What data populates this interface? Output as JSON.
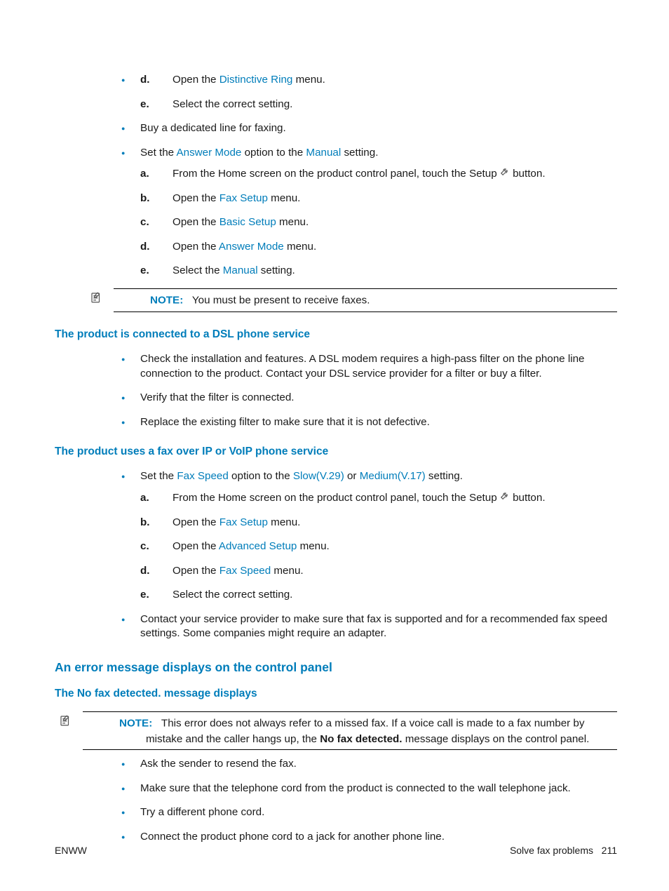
{
  "colors": {
    "accent": "#007dba"
  },
  "icons": {
    "note": "note-icon",
    "wrench": "wrench-icon"
  },
  "top_list": {
    "ol_cont": [
      {
        "m": "d.",
        "pre": "Open the ",
        "ui": "Distinctive Ring",
        "post": " menu."
      },
      {
        "m": "e.",
        "text": "Select the correct setting."
      }
    ],
    "item_buy": "Buy a dedicated line for faxing.",
    "item_set": {
      "pre": "Set the ",
      "ui1": "Answer Mode",
      "mid": " option to the ",
      "ui2": "Manual",
      "post": " setting."
    },
    "set_steps": [
      {
        "m": "a.",
        "pre": "From the Home screen on the product control panel, touch the Setup ",
        "post": " button."
      },
      {
        "m": "b.",
        "pre": "Open the ",
        "ui": "Fax Setup",
        "post": " menu."
      },
      {
        "m": "c.",
        "pre": "Open the ",
        "ui": "Basic Setup",
        "post": " menu."
      },
      {
        "m": "d.",
        "pre": "Open the ",
        "ui": "Answer Mode",
        "post": " menu."
      },
      {
        "m": "e.",
        "pre": "Select the ",
        "ui": "Manual",
        "post": " setting."
      }
    ],
    "note_label": "NOTE:",
    "note_text": "You must be present to receive faxes."
  },
  "dsl": {
    "heading": "The product is connected to a DSL phone service",
    "items": [
      "Check the installation and features. A DSL modem requires a high-pass filter on the phone line connection to the product. Contact your DSL service provider for a filter or buy a filter.",
      "Verify that the filter is connected.",
      "Replace the existing filter to make sure that it is not defective."
    ]
  },
  "voip": {
    "heading": "The product uses a fax over IP or VoIP phone service",
    "item_set": {
      "pre": "Set the ",
      "ui1": "Fax Speed",
      "mid1": " option to the ",
      "ui2": "Slow(V.29)",
      "mid2": " or ",
      "ui3": "Medium(V.17)",
      "post": " setting."
    },
    "steps": [
      {
        "m": "a.",
        "pre": "From the Home screen on the product control panel, touch the Setup ",
        "post": " button."
      },
      {
        "m": "b.",
        "pre": "Open the ",
        "ui": "Fax Setup",
        "post": " menu."
      },
      {
        "m": "c.",
        "pre": "Open the ",
        "ui": "Advanced Setup",
        "post": " menu."
      },
      {
        "m": "d.",
        "pre": "Open the ",
        "ui": "Fax Speed",
        "post": " menu."
      },
      {
        "m": "e.",
        "text": "Select the correct setting."
      }
    ],
    "item_contact": "Contact your service provider to make sure that fax is supported and for a recommended fax speed settings. Some companies might require an adapter."
  },
  "error": {
    "heading": "An error message displays on the control panel",
    "sub": "The No fax detected. message displays",
    "note_label": "NOTE:",
    "note_pre": "This error does not always refer to a missed fax. If a voice call is made to a fax number by mistake and the caller hangs up, the ",
    "note_bold": "No fax detected.",
    "note_post": " message displays on the control panel.",
    "items": [
      "Ask the sender to resend the fax.",
      "Make sure that the telephone cord from the product is connected to the wall telephone jack.",
      "Try a different phone cord.",
      "Connect the product phone cord to a jack for another phone line."
    ]
  },
  "footer": {
    "left": "ENWW",
    "right_label": "Solve fax problems",
    "right_page": "211"
  }
}
